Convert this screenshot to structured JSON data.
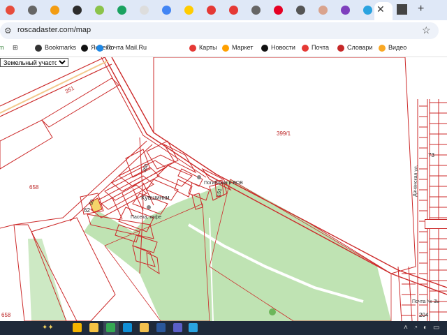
{
  "browser": {
    "tabs": [
      {
        "icon": "red-circle-icon",
        "color": "#e74c3c"
      },
      {
        "icon": "globe-icon",
        "color": "#666666"
      },
      {
        "icon": "orange-circle-icon",
        "color": "#f39c12"
      },
      {
        "icon": "dark-square-icon",
        "color": "#2c2c2c"
      },
      {
        "icon": "green-circle-icon",
        "color": "#8bc34a"
      },
      {
        "icon": "green-badge-icon",
        "color": "#1aa260"
      },
      {
        "icon": "photo-icon",
        "color": "#dddddd"
      },
      {
        "icon": "multicolor-icon",
        "color": "#4285f4"
      },
      {
        "icon": "yandex-market-icon",
        "color": "#ffcc00"
      },
      {
        "icon": "swiss-red-icon",
        "color": "#e53935"
      },
      {
        "icon": "swiss-red-icon",
        "color": "#e53935"
      },
      {
        "icon": "globe-icon",
        "color": "#666666"
      },
      {
        "icon": "pinterest-icon",
        "color": "#e60023"
      },
      {
        "icon": "compass-icon",
        "color": "#555555"
      },
      {
        "icon": "avatar-icon",
        "color": "#d9a38d"
      },
      {
        "icon": "purple-square-icon",
        "color": "#7e3fbd"
      },
      {
        "icon": "telegram-icon",
        "color": "#2aa3e0"
      }
    ],
    "active_tab_close": "✕",
    "new_tab": "+",
    "url": "roscadaster.com/map"
  },
  "bookmarks": {
    "items": [
      {
        "label": "Bookmarks",
        "icon": "star-icon",
        "color": "#333333"
      },
      {
        "label": "Яндекс",
        "icon": "yandex-icon",
        "color": "#111111"
      },
      {
        "label": "Почта Mail.Ru",
        "icon": "mail-ru-icon",
        "color": "#1e88e5"
      },
      {
        "label": "Карты",
        "icon": "map-pin-icon",
        "color": "#e53935"
      },
      {
        "label": "Маркет",
        "icon": "market-icon",
        "color": "#ffa000"
      },
      {
        "label": "Новости",
        "icon": "news-icon",
        "color": "#111111"
      },
      {
        "label": "Почта",
        "icon": "mail-icon",
        "color": "#e53935"
      },
      {
        "label": "Словари",
        "icon": "dictionary-icon",
        "color": "#c62828"
      },
      {
        "label": "Видео",
        "icon": "video-icon",
        "color": "#f9a825"
      }
    ]
  },
  "map": {
    "layer_option": "Земельный участок",
    "parcel_color": "#cc2a2a",
    "park_color": "#bfe3b3",
    "labels": {
      "l351": "351",
      "l399": "399/1",
      "l658a": "658",
      "l658b": "658",
      "l62": "62",
      "l80": "80",
      "l280": "280",
      "l151": "151",
      "l73": "73",
      "l204": "204",
      "kuv": "Кувшинки",
      "pog": "Погибшим в ВОВ",
      "pos": "Пасека, кафе",
      "dal": "Дачанская ул.",
      "pochta": "Почта № 3Ь"
    }
  },
  "taskbar": {
    "apps": [
      {
        "icon": "copilot-icon",
        "color": "#f4b400"
      },
      {
        "icon": "file-explorer-icon",
        "color": "#f6c343"
      },
      {
        "icon": "chrome-icon",
        "color": "#34a853"
      },
      {
        "icon": "edge-icon",
        "color": "#0f8fd6"
      },
      {
        "icon": "folder-icon",
        "color": "#f2c14e"
      },
      {
        "icon": "word-icon",
        "color": "#2b579a"
      },
      {
        "icon": "app-icon",
        "color": "#5b5fc7"
      },
      {
        "icon": "telegram-icon",
        "color": "#2aa3e0"
      }
    ]
  }
}
